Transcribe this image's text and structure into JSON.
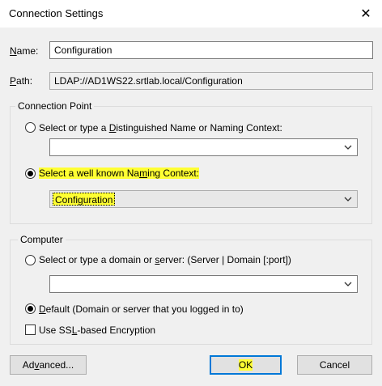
{
  "window": {
    "title": "Connection Settings",
    "close_glyph": "✕"
  },
  "name": {
    "label_underlined": "N",
    "label_rest": "ame:",
    "value": "Configuration"
  },
  "path": {
    "label_underlined": "P",
    "label_rest": "ath:",
    "value": "LDAP://AD1WS22.srtlab.local/Configuration"
  },
  "connection_point": {
    "legend": "Connection Point",
    "radio_dn": {
      "pre": "Select or type a ",
      "underlined": "D",
      "post": "istinguished Name or Naming Context:",
      "checked": false
    },
    "dn_combo_value": "",
    "radio_known": {
      "pre": "Select a well known Na",
      "underlined": "m",
      "post": "ing Context:",
      "checked": true
    },
    "known_combo_value": "Configuration"
  },
  "computer": {
    "legend": "Computer",
    "radio_server": {
      "pre": "Select or type a domain or ",
      "underlined": "s",
      "post": "erver: (Server | Domain [:port])",
      "checked": false
    },
    "server_combo_value": "",
    "radio_default": {
      "underlined": "D",
      "post": "efault (Domain or server that you logged in to)",
      "checked": true
    },
    "ssl": {
      "pre": "Use SS",
      "underlined": "L",
      "post": "-based Encryption",
      "checked": false
    }
  },
  "buttons": {
    "advanced": {
      "pre": "Ad",
      "underlined": "v",
      "post": "anced..."
    },
    "ok": "OK",
    "cancel": "Cancel"
  },
  "colors": {
    "highlight": "#ffff33",
    "default_button_border": "#0078d7"
  },
  "icons": {
    "close": "close-icon",
    "chevron": "chevron-down-icon"
  }
}
